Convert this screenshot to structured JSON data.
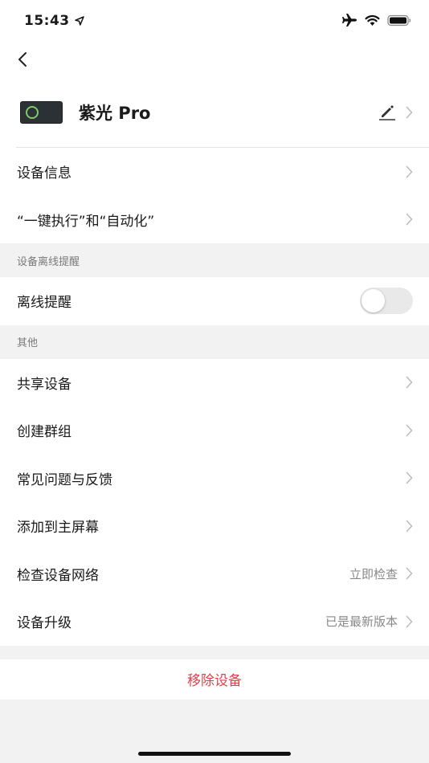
{
  "status_bar": {
    "time": "15:43"
  },
  "device": {
    "name": "紫光 Pro"
  },
  "group1": [
    {
      "label": "设备信息"
    },
    {
      "label": "“一键执行”和“自动化”"
    }
  ],
  "offline": {
    "section_title": "设备离线提醒",
    "label": "离线提醒",
    "enabled": false
  },
  "other": {
    "section_title": "其他",
    "items": [
      {
        "label": "共享设备",
        "value": ""
      },
      {
        "label": "创建群组",
        "value": ""
      },
      {
        "label": "常见问题与反馈",
        "value": ""
      },
      {
        "label": "添加到主屏幕",
        "value": ""
      },
      {
        "label": "检查设备网络",
        "value": "立即检查"
      },
      {
        "label": "设备升级",
        "value": "已是最新版本"
      }
    ]
  },
  "remove_label": "移除设备",
  "colors": {
    "danger": "#e0414a",
    "background": "#f2f2f2"
  }
}
